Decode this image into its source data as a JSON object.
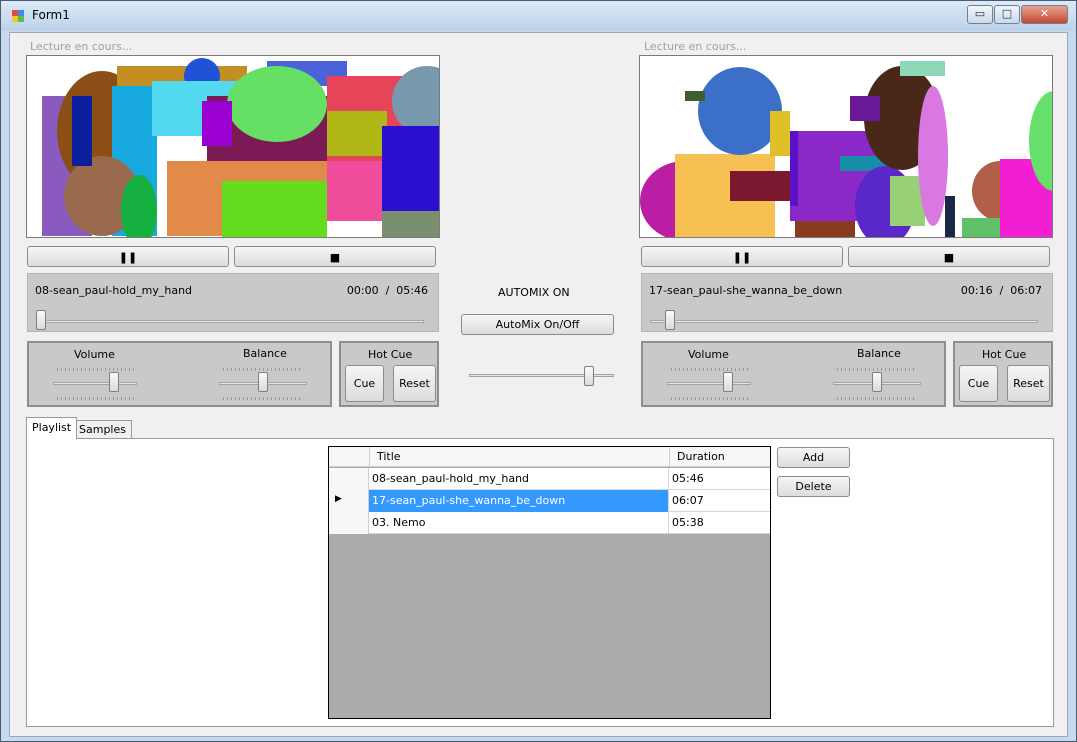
{
  "window": {
    "title": "Form1",
    "controls": {
      "minimize": "▭",
      "maximize": "□",
      "close": "✕"
    }
  },
  "deck_left": {
    "status": "Lecture en cours...",
    "pause_glyph": "❚❚",
    "stop_glyph": "■",
    "track": "08-sean_paul-hold_my_hand",
    "time_current": "00:00",
    "time_sep": "/",
    "time_total": "05:46",
    "seek_fraction": 0.0,
    "volume_label": "Volume",
    "volume_fraction": 0.75,
    "balance_label": "Balance",
    "balance_fraction": 0.5,
    "hotcue_label": "Hot Cue",
    "cue_label": "Cue",
    "reset_label": "Reset"
  },
  "deck_right": {
    "status": "Lecture en cours...",
    "pause_glyph": "❚❚",
    "stop_glyph": "■",
    "track": "17-sean_paul-she_wanna_be_down",
    "time_current": "00:16",
    "time_sep": "/",
    "time_total": "06:07",
    "seek_fraction": 0.04,
    "volume_label": "Volume",
    "volume_fraction": 0.75,
    "balance_label": "Balance",
    "balance_fraction": 0.5,
    "hotcue_label": "Hot Cue",
    "cue_label": "Cue",
    "reset_label": "Reset"
  },
  "automix": {
    "status": "AUTOMIX ON",
    "toggle_label": "AutoMix On/Off",
    "crossfader_fraction": 0.85
  },
  "tabs": [
    {
      "label": "Playlist",
      "active": true
    },
    {
      "label": "Samples",
      "active": false
    }
  ],
  "playlist": {
    "columns": [
      "Title",
      "Duration"
    ],
    "rows": [
      {
        "title": "08-sean_paul-hold_my_hand",
        "duration": "05:46",
        "selected": false,
        "current": false
      },
      {
        "title": "17-sean_paul-she_wanna_be_down",
        "duration": "06:07",
        "selected": true,
        "current": true
      },
      {
        "title": "03. Nemo",
        "duration": "05:38",
        "selected": false,
        "current": false
      }
    ],
    "current_marker": "▶",
    "add_label": "Add",
    "delete_label": "Delete"
  },
  "colors": {
    "selection": "#3399ff",
    "panel": "#c9c9c9",
    "form_bg": "#f0f0f0",
    "grid_empty": "#ababab"
  }
}
